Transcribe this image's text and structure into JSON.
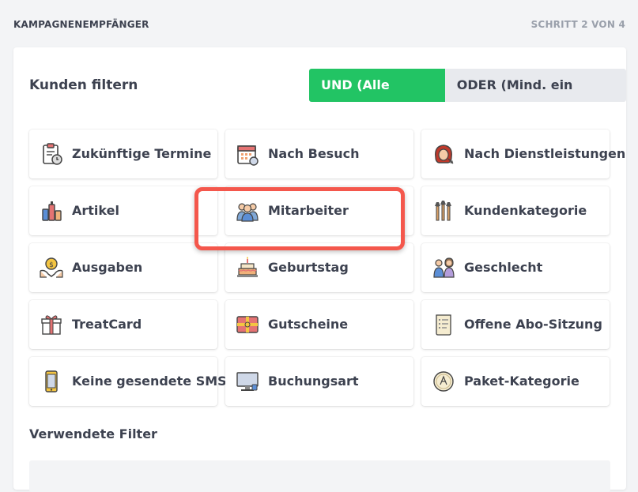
{
  "header": {
    "title": "KAMPAGNENEMPFÄNGER",
    "step": "SCHRITT 2 VON 4"
  },
  "filter": {
    "heading": "Kunden filtern",
    "mode_and": "UND (Alle Filter)",
    "mode_or": "ODER (Mind. ein Filter)"
  },
  "tiles": [
    {
      "label": "Zukünftige Termine",
      "icon": "clipboard-clock-icon"
    },
    {
      "label": "Nach Besuch",
      "icon": "calendar-icon"
    },
    {
      "label": "Nach Dienstleistungen",
      "icon": "hairdresser-icon"
    },
    {
      "label": "Artikel",
      "icon": "cosmetics-icon"
    },
    {
      "label": "Mitarbeiter",
      "icon": "team-icon"
    },
    {
      "label": "Kundenkategorie",
      "icon": "brushes-icon"
    },
    {
      "label": "Ausgaben",
      "icon": "coin-hands-icon"
    },
    {
      "label": "Geburtstag",
      "icon": "birthday-cake-icon"
    },
    {
      "label": "Geschlecht",
      "icon": "man-woman-icon"
    },
    {
      "label": "TreatCard",
      "icon": "gift-box-icon"
    },
    {
      "label": "Gutscheine",
      "icon": "voucher-icon"
    },
    {
      "label": "Offene Abo-Sitzung",
      "icon": "scroll-list-icon"
    },
    {
      "label": "Keine gesendete SMS",
      "icon": "smartphone-icon"
    },
    {
      "label": "Buchungsart",
      "icon": "monitor-icon"
    },
    {
      "label": "Paket-Kategorie",
      "icon": "compass-badge-icon"
    }
  ],
  "used": {
    "heading": "Verwendete Filter"
  },
  "colors": {
    "accent": "#22c464",
    "highlight": "#f4574c"
  }
}
